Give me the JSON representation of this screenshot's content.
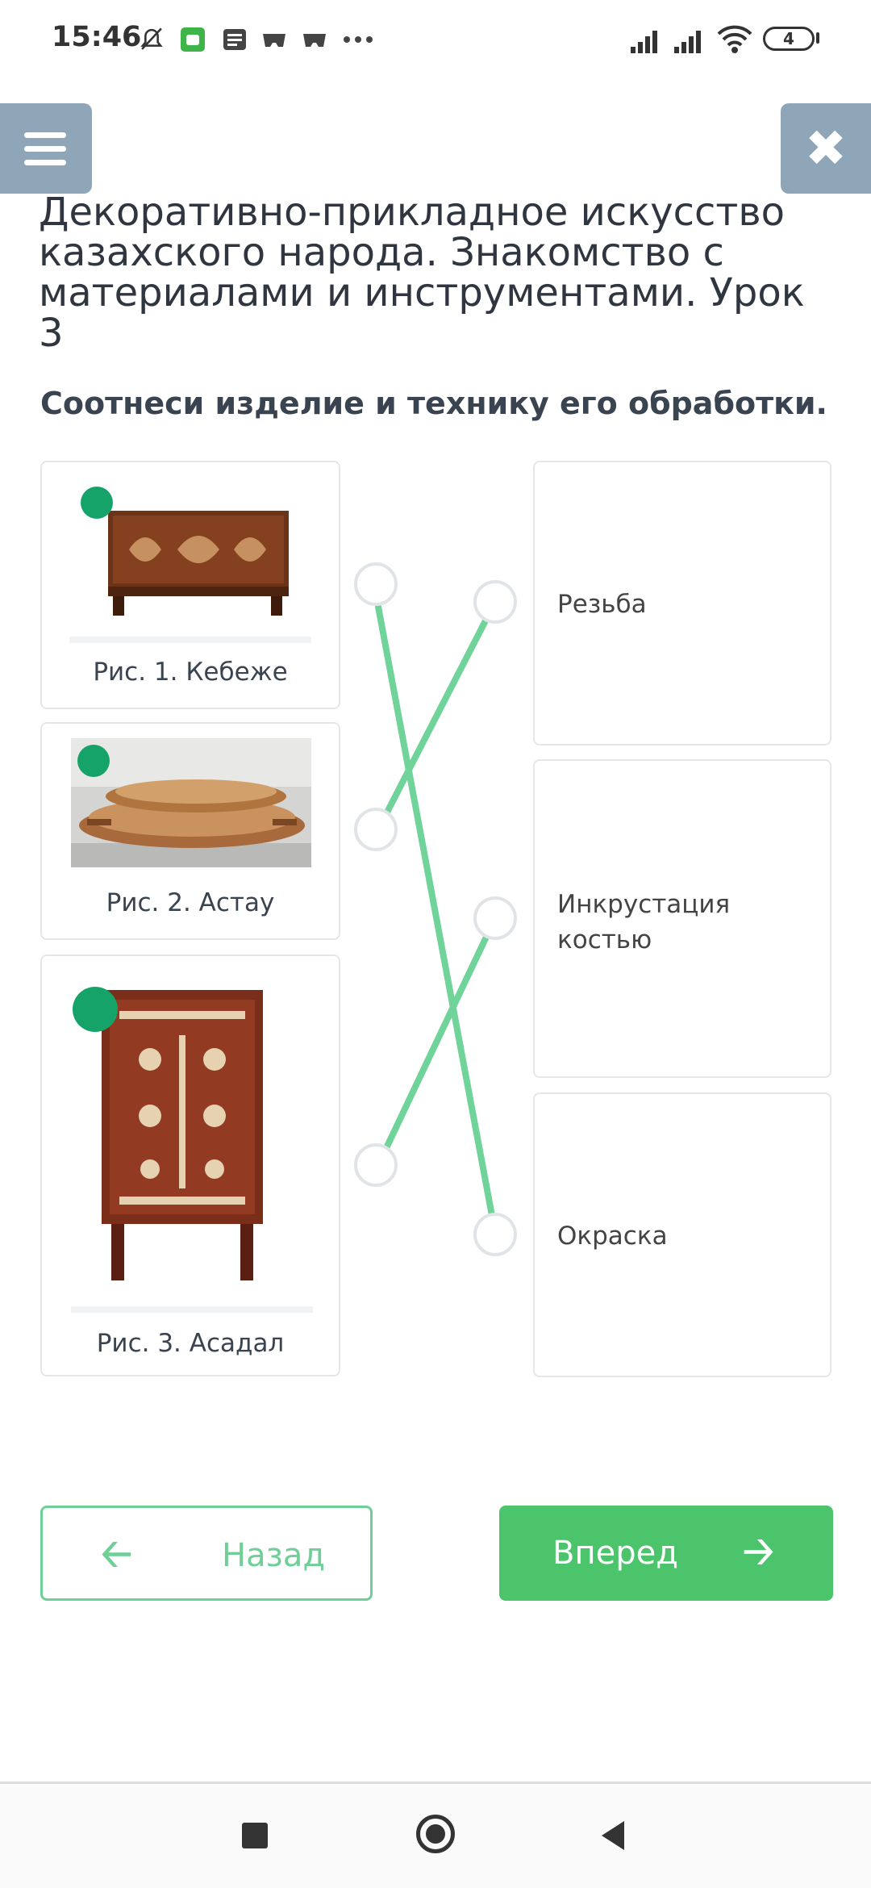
{
  "status_bar": {
    "time": "15:46",
    "icons": [
      "mute-icon",
      "android-icon",
      "news-icon",
      "game-icon",
      "game-icon",
      "more-icon"
    ],
    "battery_level": "4"
  },
  "header": {
    "title": "Декоративно-прикладное искусство казахского народа. Знакомство с материалами и инструментами. Урок 3"
  },
  "task": {
    "instruction": "Соотнеси изделие и технику его обработки."
  },
  "items": [
    {
      "caption": "Рис. 1. Кебеже",
      "image": "wooden-chest"
    },
    {
      "caption": "Рис. 2. Астау",
      "image": "wooden-trays"
    },
    {
      "caption": "Рис. 3. Асадал",
      "image": "decorated-cabinet"
    }
  ],
  "targets": [
    {
      "label": "Резьба"
    },
    {
      "label": "Инкрустация костью"
    },
    {
      "label": "Окраска"
    }
  ],
  "connections": [
    {
      "item": 1,
      "target": 3
    },
    {
      "item": 2,
      "target": 1
    },
    {
      "item": 3,
      "target": 2
    }
  ],
  "colors": {
    "accent": "#4cc46b",
    "line": "#6fd39a",
    "menu": "#8ea6b7"
  },
  "nav": {
    "back_label": "Назад",
    "next_label": "Вперед"
  }
}
